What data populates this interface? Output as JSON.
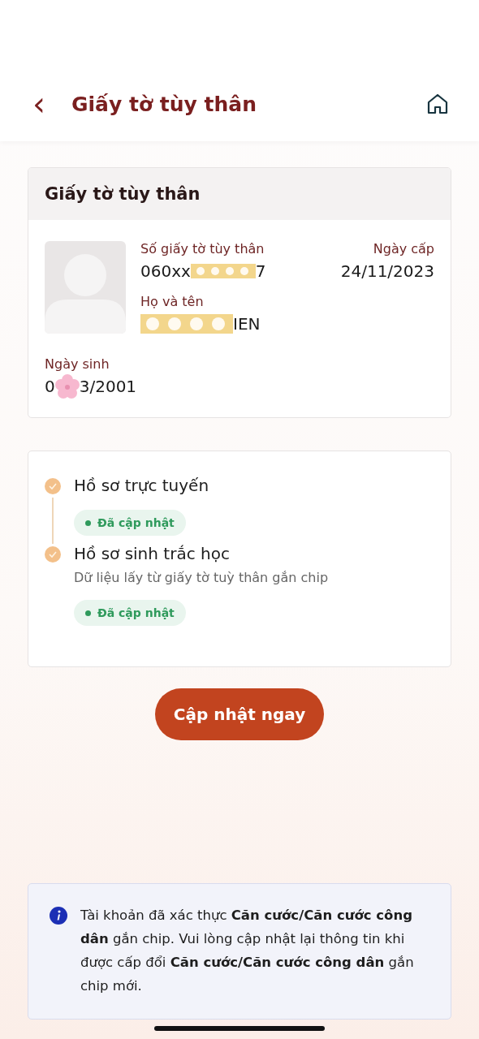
{
  "header": {
    "back_icon": "‹",
    "title": "Giấy tờ tùy thân"
  },
  "id_card": {
    "title": "Giấy tờ tùy thân",
    "id_number": {
      "label": "Số giấy tờ tùy thân",
      "before": "060xx",
      "kind": "tape",
      "after": "7"
    },
    "issue_date": {
      "label": "Ngày cấp",
      "value": "24/11/2023"
    },
    "full_name": {
      "label": "Họ và tên",
      "kind": "tape",
      "after": "IEN"
    },
    "birth_date": {
      "label": "Ngày sinh",
      "before": "0",
      "kind": "flower",
      "after": "3/2001"
    }
  },
  "steps": [
    {
      "title": "Hồ sơ trực tuyến",
      "done": true,
      "status": "Đã cập nhật"
    },
    {
      "title": "Hồ sơ sinh trắc học",
      "subtitle": "Dữ liệu lấy từ giấy tờ tuỳ thân gắn chip",
      "done": true,
      "status": "Đã cập nhật"
    }
  ],
  "update_button": "Cập nhật ngay",
  "notice": "Tài khoản đã xác thực **Căn cước/Căn cước công dân** gắn chip. Vui lòng cập nhật lại thông tin khi được cấp đổi **Căn cước/Căn cước công dân** gắn chip mới."
}
